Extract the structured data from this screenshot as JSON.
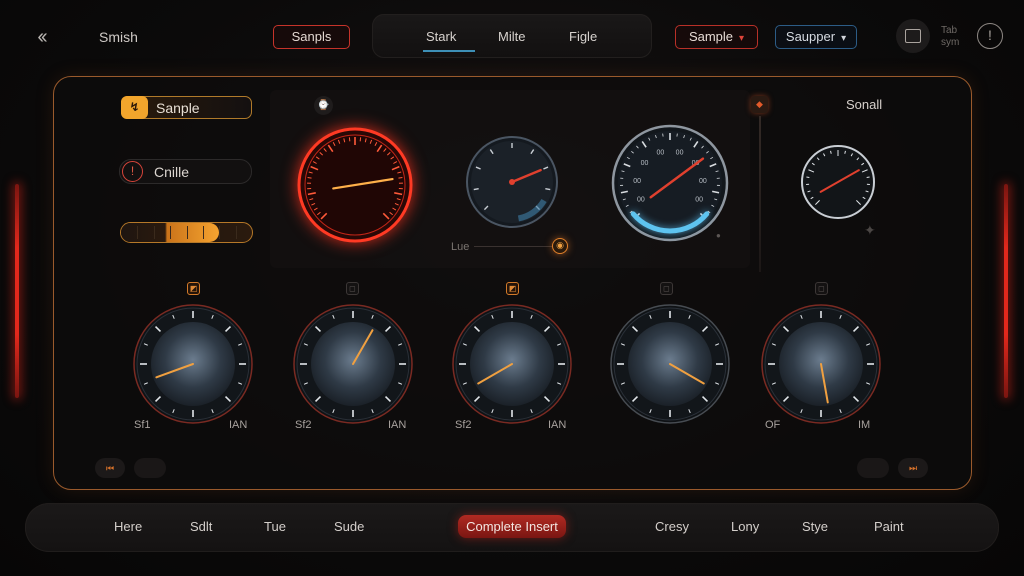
{
  "header": {
    "back_glyph": "‹‹",
    "title": "Smish",
    "samples_button": "Sanpls",
    "tabs": [
      {
        "label": "Stark",
        "active": true
      },
      {
        "label": "Milte",
        "active": false
      },
      {
        "label": "Figle",
        "active": false
      }
    ],
    "dropdown_1": {
      "value": "Sample",
      "caret": "▾"
    },
    "dropdown_2": {
      "value": "Saupper",
      "caret": "▾"
    },
    "tap_text": [
      "Tab",
      "sym"
    ],
    "info_glyph": "!"
  },
  "controls": {
    "sample_button": {
      "label": "Sanple",
      "icon": "bolt-icon",
      "icon_glyph": "↯"
    },
    "chille_button": {
      "label": "Cnille",
      "icon": "alert-icon",
      "icon_glyph": "!"
    },
    "slider": {
      "level_percent": 75
    }
  },
  "gauges": {
    "small_label": "Sonall",
    "lue_label": "Lue",
    "clock_glyph": "⌚",
    "warn_glyph": "◆",
    "knob_glyph": "◉",
    "sparkle_glyph": "✦",
    "dot_glyph": "●",
    "top": [
      {
        "name": "red-glow-gauge",
        "level_percent": 80
      },
      {
        "name": "dial-gauge-2",
        "level_percent": 75
      },
      {
        "name": "dial-gauge-3",
        "scale_labels": [
          "00",
          "00",
          "00",
          "00",
          "00",
          "00",
          "00",
          "00"
        ],
        "level_percent": 55
      },
      {
        "name": "dial-gauge-4",
        "level_percent": 65
      }
    ],
    "knobs": [
      {
        "badge_on": true,
        "label_left": "Sf1",
        "label_right": "IAN"
      },
      {
        "badge_on": false,
        "label_left": "Sf2",
        "label_right": "IAN"
      },
      {
        "badge_on": true,
        "label_left": "Sf2",
        "label_right": "IAN"
      },
      {
        "badge_on": false,
        "label_left": "",
        "label_right": ""
      },
      {
        "badge_on": false,
        "label_left": "OF",
        "label_right": "IM"
      }
    ]
  },
  "pager": {
    "prev_glyph": "⏮",
    "next_glyph": "⏭"
  },
  "bottom_nav": {
    "items_left": [
      "Here",
      "Sdlt",
      "Tue",
      "Sude"
    ],
    "active": "Complete Insert",
    "items_right": [
      "Cresy",
      "Lony",
      "Stye",
      "Paint"
    ]
  },
  "colors": {
    "accent_red": "#e2281c",
    "accent_orange": "#f2a52c",
    "accent_blue": "#3d8fb6"
  }
}
